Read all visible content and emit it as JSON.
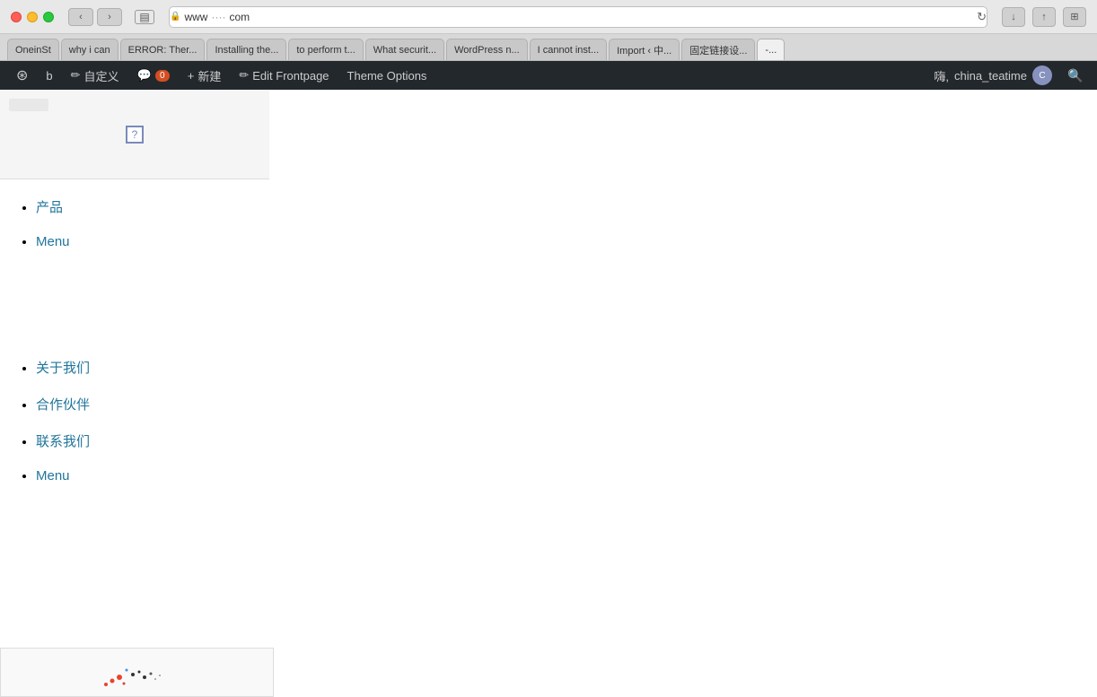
{
  "title_bar": {
    "url_left": "www",
    "url_right": "com",
    "traffic_lights": [
      "red",
      "yellow",
      "green"
    ]
  },
  "browser_tabs": [
    {
      "label": "OneinSt",
      "active": false
    },
    {
      "label": "why i can",
      "active": false
    },
    {
      "label": "ERROR: Ther...",
      "active": false
    },
    {
      "label": "Installing the...",
      "active": false
    },
    {
      "label": "to perform t...",
      "active": false
    },
    {
      "label": "What securit...",
      "active": false
    },
    {
      "label": "WordPress n...",
      "active": false
    },
    {
      "label": "I cannot inst...",
      "active": false
    },
    {
      "label": "Import ‹ 中...",
      "active": false
    },
    {
      "label": "固定链接设...",
      "active": false
    },
    {
      "label": "-...",
      "active": true
    }
  ],
  "wp_admin_bar": {
    "wp_logo": "W",
    "site_name": "b",
    "customize_label": "自定义",
    "comments_label": "0",
    "new_label": "新建",
    "edit_frontpage_label": "Edit Frontpage",
    "theme_options_label": "Theme Options",
    "user_greeting": "嗨,",
    "username": "china_teatime",
    "search_placeholder": "搜索"
  },
  "page": {
    "nav_items": [
      {
        "text": "产品",
        "href": "#"
      },
      {
        "text": "Menu",
        "href": "#"
      }
    ],
    "footer_nav_items": [
      {
        "text": "关于我们",
        "href": "#"
      },
      {
        "text": "合作伙伴",
        "href": "#"
      },
      {
        "text": "联系我们",
        "href": "#"
      },
      {
        "text": "Menu",
        "href": "#"
      }
    ]
  },
  "icons": {
    "back": "‹",
    "forward": "›",
    "reload": "↻",
    "sidebar": "▤",
    "download": "↓",
    "share": "↑",
    "extensions": "⊞",
    "lock": "🔒",
    "broken_img": "?",
    "pencil": "✏",
    "comment": "💬",
    "plus": "+",
    "search": "🔍"
  }
}
